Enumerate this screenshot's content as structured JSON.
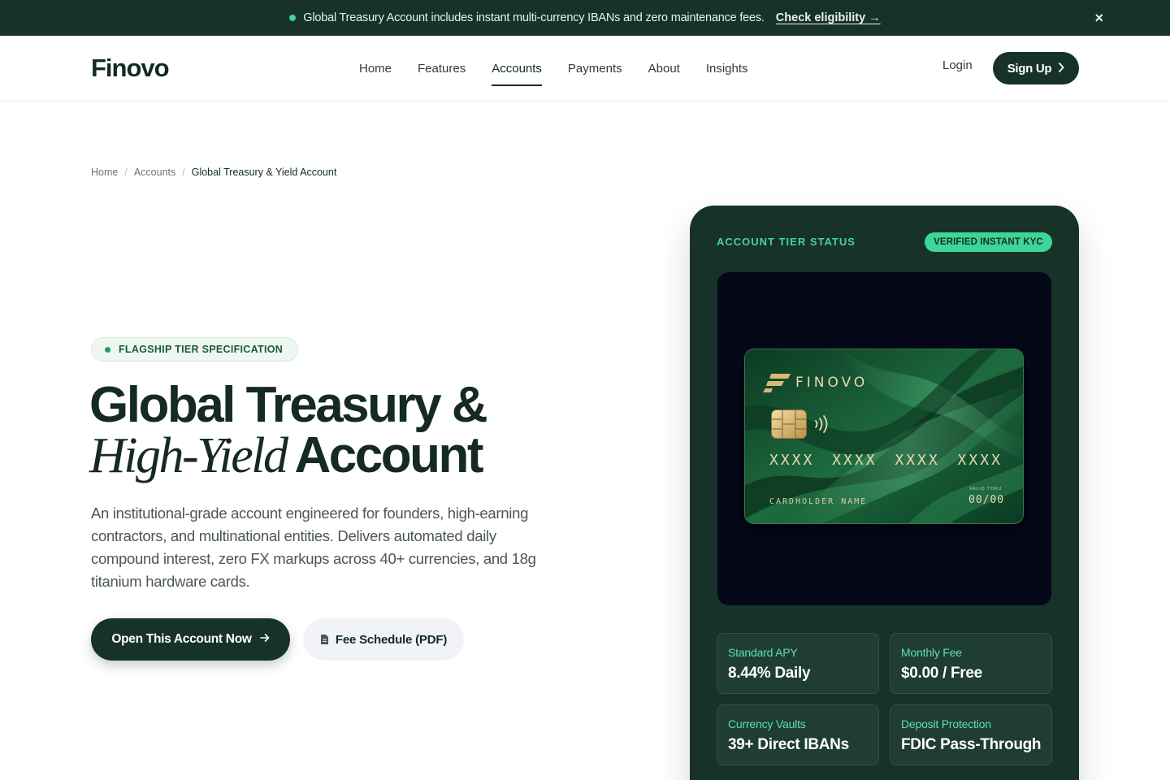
{
  "announcement": {
    "message": "Global Treasury Account includes instant multi-currency IBANs and zero maintenance fees.",
    "cta": "Check eligibility →",
    "close": "×"
  },
  "header": {
    "logo": "Finovo",
    "nav": [
      {
        "label": "Home",
        "active": false
      },
      {
        "label": "Features",
        "active": false
      },
      {
        "label": "Accounts",
        "active": true
      },
      {
        "label": "Payments",
        "active": false
      },
      {
        "label": "About",
        "active": false
      },
      {
        "label": "Insights",
        "active": false
      }
    ],
    "login": "Login",
    "signup": "Sign Up"
  },
  "breadcrumb": {
    "items": [
      "Home",
      "Accounts"
    ],
    "current": "Global Treasury & Yield Account"
  },
  "hero": {
    "pill": "FLAGSHIP TIER SPECIFICATION",
    "headline_line1": "Global Treasury &",
    "headline_italic": "High-Yield",
    "headline_line2_end": "Account",
    "description": "An institutional-grade account engineered for founders, high-earning contractors, and multinational entities. Delivers automated daily compound interest, zero FX markups across 40+ currencies, and 18g titanium hardware cards.",
    "primary_button": "Open This Account Now",
    "secondary_button": "Fee Schedule (PDF)"
  },
  "panel": {
    "title": "ACCOUNT TIER STATUS",
    "badge": "VERIFIED INSTANT KYC",
    "card": {
      "brand": "FINOVO",
      "number": "XXXX XXXX XXXX XXXX",
      "holder": "CARDHOLDER NAME",
      "valid_label": "VALID THRU",
      "expiry": "00/00"
    },
    "stats": [
      {
        "label": "Standard APY",
        "value": "8.44% Daily"
      },
      {
        "label": "Monthly Fee",
        "value": "$0.00 / Free"
      },
      {
        "label": "Currency Vaults",
        "value": "39+ Direct IBANs"
      },
      {
        "label": "Deposit Protection",
        "value": "FDIC Pass-Through"
      }
    ]
  },
  "colors": {
    "brand_dark": "#163229",
    "accent_green": "#3ed598",
    "card_gold": "#e8d9b2"
  },
  "icons": [
    "status-dot",
    "close-icon",
    "chevron-right-icon",
    "arrow-right-icon",
    "document-icon",
    "card-chip-icon",
    "contactless-icon",
    "finovo-logo-mark"
  ]
}
